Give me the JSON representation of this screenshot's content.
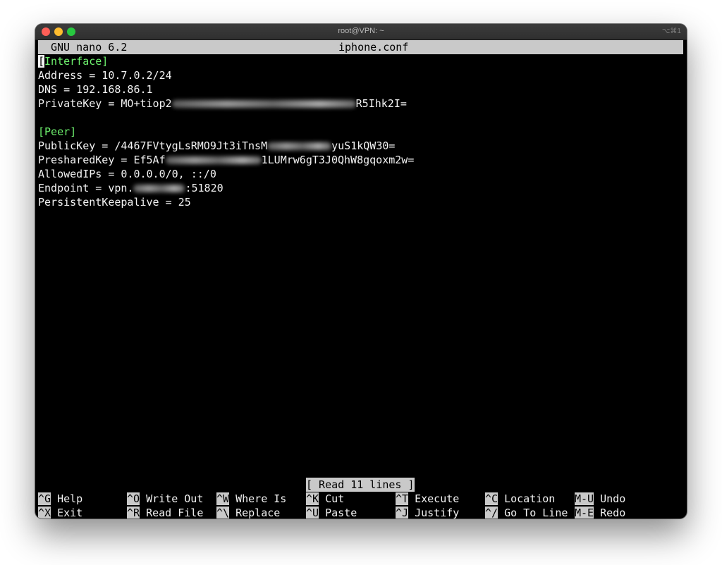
{
  "window": {
    "title": "root@VPN: ~",
    "shortcut": "⌥⌘1"
  },
  "nano": {
    "version": "GNU nano 6.2",
    "filename": "iphone.conf",
    "status": "[ Read 11 lines ]"
  },
  "file": {
    "interface_header": "[Interface]",
    "interface_header_first_char": "[",
    "interface_header_rest": "Interface]",
    "address": "Address = 10.7.0.2/24",
    "dns": "DNS = 192.168.86.1",
    "private_key_prefix": "PrivateKey = MO+tiop2",
    "private_key_suffix": "R5Ihk2I=",
    "peer_header": "[Peer]",
    "public_key_prefix": "PublicKey = /4467FVtygLsRMO9Jt3iTnsM",
    "public_key_suffix": "yuS1kQW30=",
    "preshared_key_prefix": "PresharedKey = Ef5Af",
    "preshared_key_suffix": "1LUMrw6gT3J0QhW8gqoxm2w=",
    "allowed_ips": "AllowedIPs = 0.0.0.0/0, ::/0",
    "endpoint_prefix": "Endpoint = vpn.",
    "endpoint_suffix": ":51820",
    "keepalive": "PersistentKeepalive = 25"
  },
  "shortcuts": [
    {
      "key": "^G",
      "label": "Help"
    },
    {
      "key": "^X",
      "label": "Exit"
    },
    {
      "key": "^O",
      "label": "Write Out"
    },
    {
      "key": "^R",
      "label": "Read File"
    },
    {
      "key": "^W",
      "label": "Where Is"
    },
    {
      "key": "^\\",
      "label": "Replace"
    },
    {
      "key": "^K",
      "label": "Cut"
    },
    {
      "key": "^U",
      "label": "Paste"
    },
    {
      "key": "^T",
      "label": "Execute"
    },
    {
      "key": "^J",
      "label": "Justify"
    },
    {
      "key": "^C",
      "label": "Location"
    },
    {
      "key": "^/",
      "label": "Go To Line"
    },
    {
      "key": "M-U",
      "label": "Undo"
    },
    {
      "key": "M-E",
      "label": "Redo"
    }
  ],
  "colors": {
    "section_header": "#6df06d",
    "background": "#000000",
    "text": "#f2f2f2",
    "bar": "#c9c9c9"
  }
}
